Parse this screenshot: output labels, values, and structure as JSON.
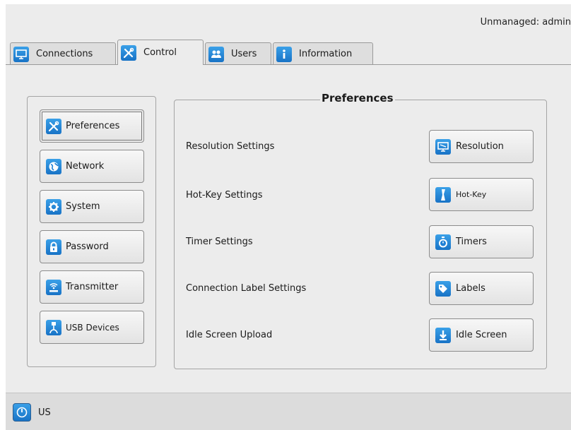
{
  "header": {
    "user_status": "Unmanaged: admin"
  },
  "tabs": [
    {
      "label": "Connections",
      "icon": "monitor-icon"
    },
    {
      "label": "Control",
      "icon": "tools-icon",
      "active": true
    },
    {
      "label": "Users",
      "icon": "users-icon"
    },
    {
      "label": "Information",
      "icon": "info-icon"
    }
  ],
  "sidebar": {
    "items": [
      {
        "label": "Preferences",
        "icon": "tools-icon",
        "selected": true
      },
      {
        "label": "Network",
        "icon": "globe-icon"
      },
      {
        "label": "System",
        "icon": "gear-icon"
      },
      {
        "label": "Password",
        "icon": "lock-icon"
      },
      {
        "label": "Transmitter",
        "icon": "transmitter-icon"
      },
      {
        "label": "USB Devices",
        "icon": "usb-icon"
      }
    ]
  },
  "preferences": {
    "title": "Preferences",
    "rows": [
      {
        "label": "Resolution Settings",
        "button": "Resolution",
        "icon": "display-icon"
      },
      {
        "label": "Hot-Key Settings",
        "button": "Hot-Key",
        "icon": "keyboard-icon"
      },
      {
        "label": "Timer Settings",
        "button": "Timers",
        "icon": "stopwatch-icon"
      },
      {
        "label": "Connection Label Settings",
        "button": "Labels",
        "icon": "tag-icon"
      },
      {
        "label": "Idle Screen Upload",
        "button": "Idle Screen",
        "icon": "download-icon"
      }
    ]
  },
  "footer": {
    "keyboard_layout": "US",
    "icon": "power-icon"
  },
  "colors": {
    "accent": "#1d7fd6",
    "background": "#ececec",
    "footer": "#dcdcdc"
  }
}
